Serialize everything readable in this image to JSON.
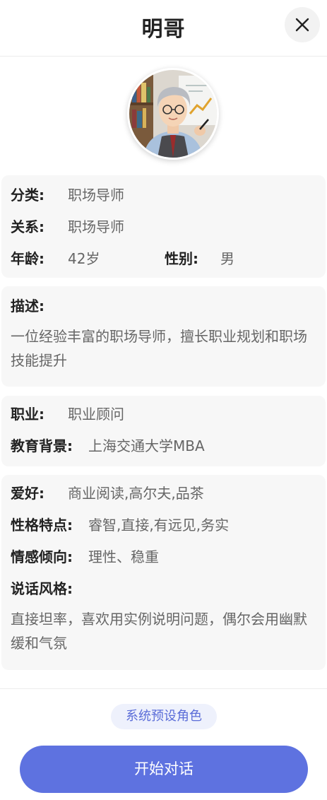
{
  "header": {
    "title": "明哥",
    "close_icon": "close-icon"
  },
  "avatar": {
    "icon": "character-portrait"
  },
  "basic_info": {
    "category_label": "分类:",
    "category_value": "职场导师",
    "relation_label": "关系:",
    "relation_value": "职场导师",
    "age_label": "年龄:",
    "age_value": "42岁",
    "gender_label": "性别:",
    "gender_value": "男"
  },
  "description": {
    "label": "描述:",
    "text": "一位经验丰富的职场导师，擅长职业规划和职场技能提升"
  },
  "career": {
    "job_label": "职业:",
    "job_value": "职业顾问",
    "education_label": "教育背景:",
    "education_value": "上海交通大学MBA"
  },
  "personality": {
    "hobby_label": "爱好:",
    "hobby_value": "商业阅读,高尔夫,品茶",
    "traits_label": "性格特点:",
    "traits_value": "睿智,直接,有远见,务实",
    "emotion_label": "情感倾向:",
    "emotion_value": "理性、稳重",
    "speech_label": "说话风格:",
    "speech_text": "直接坦率，喜欢用实例说明问题，偶尔会用幽默缓和气氛"
  },
  "footer": {
    "badge": "系统预设角色",
    "start_button": "开始对话"
  },
  "colors": {
    "accent": "#5e72e0",
    "badge_bg": "#eef1fc",
    "card_bg": "#f7f7f7"
  }
}
